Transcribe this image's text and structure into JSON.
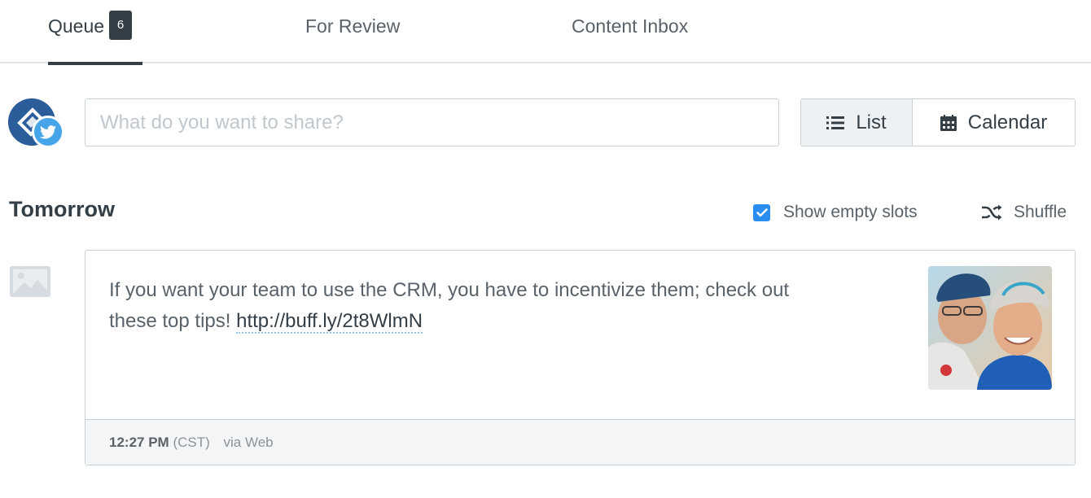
{
  "tabs": [
    {
      "label": "Queue",
      "badge": "6",
      "active": true
    },
    {
      "label": "For Review",
      "active": false
    },
    {
      "label": "Content Inbox",
      "active": false
    }
  ],
  "composer": {
    "placeholder": "What do you want to share?",
    "avatar_icon": "profile-avatar",
    "network_icon": "twitter-icon"
  },
  "view_toggle": {
    "list_label": "List",
    "calendar_label": "Calendar",
    "selected": "List"
  },
  "day": {
    "title": "Tomorrow",
    "show_empty_slots_label": "Show empty slots",
    "show_empty_slots_checked": true,
    "shuffle_label": "Shuffle"
  },
  "post": {
    "text": "If you want your team to use the CRM, you have to incentivize them; check out these top tips! ",
    "link": "http://buff.ly/2t8WlmN",
    "time": "12:27 PM",
    "timezone": "(CST)",
    "via": "via Web",
    "type_icon": "image-icon"
  },
  "colors": {
    "accent": "#2c8df0",
    "twitter": "#45a5e8",
    "text_dark": "#343e47",
    "border": "#c8d1d9"
  }
}
